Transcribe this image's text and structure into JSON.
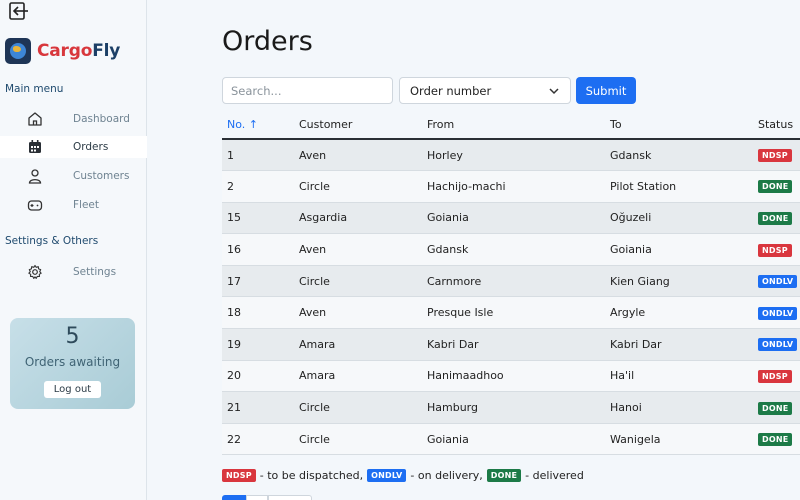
{
  "app": {
    "brand_part1": "Cargo",
    "brand_part2": "Fly"
  },
  "sidebar": {
    "main_menu_label": "Main menu",
    "items": [
      {
        "label": "Dashboard",
        "icon": "home-icon",
        "active": false
      },
      {
        "label": "Orders",
        "icon": "calendar-icon",
        "active": true
      },
      {
        "label": "Customers",
        "icon": "user-icon",
        "active": false
      },
      {
        "label": "Fleet",
        "icon": "gamepad-icon",
        "active": false
      }
    ],
    "settings_section_label": "Settings & Others",
    "settings_item": {
      "label": "Settings",
      "icon": "gear-icon"
    },
    "awaiting": {
      "count": "5",
      "label": "Orders awaiting",
      "logout_label": "Log out"
    }
  },
  "main": {
    "title": "Orders",
    "search": {
      "placeholder": "Search...",
      "value": ""
    },
    "sort_select": {
      "selected": "Order number"
    },
    "submit_label": "Submit",
    "table": {
      "headers": {
        "no": "No. ↑",
        "customer": "Customer",
        "from": "From",
        "to": "To",
        "status": "Status"
      },
      "rows": [
        {
          "no": "1",
          "customer": "Aven",
          "from": "Horley",
          "to": "Gdansk",
          "status": "NDSP"
        },
        {
          "no": "2",
          "customer": "Circle",
          "from": "Hachijo-machi",
          "to": "Pilot Station",
          "status": "DONE"
        },
        {
          "no": "15",
          "customer": "Asgardia",
          "from": "Goiania",
          "to": "Oğuzeli",
          "status": "DONE"
        },
        {
          "no": "16",
          "customer": "Aven",
          "from": "Gdansk",
          "to": "Goiania",
          "status": "NDSP"
        },
        {
          "no": "17",
          "customer": "Circle",
          "from": "Carnmore",
          "to": "Kien Giang",
          "status": "ONDLV"
        },
        {
          "no": "18",
          "customer": "Aven",
          "from": "Presque Isle",
          "to": "Argyle",
          "status": "ONDLV"
        },
        {
          "no": "19",
          "customer": "Amara",
          "from": "Kabri Dar",
          "to": "Kabri Dar",
          "status": "ONDLV"
        },
        {
          "no": "20",
          "customer": "Amara",
          "from": "Hanimaadhoo",
          "to": "Ha'il",
          "status": "NDSP"
        },
        {
          "no": "21",
          "customer": "Circle",
          "from": "Hamburg",
          "to": "Hanoi",
          "status": "DONE"
        },
        {
          "no": "22",
          "customer": "Circle",
          "from": "Goiania",
          "to": "Wanigela",
          "status": "DONE"
        }
      ]
    },
    "legend": {
      "ndsp_badge": "NDSP",
      "ndsp_text": "- to be dispatched,",
      "ondlv_badge": "ONDLV",
      "ondlv_text": "- on delivery,",
      "done_badge": "DONE",
      "done_text": "- delivered"
    }
  },
  "colors": {
    "accent": "#1d6ef2",
    "ndsp": "#d9363e",
    "done": "#1c7a47",
    "ondlv": "#1d6ef2",
    "brand_red": "#d8373c",
    "brand_navy": "#1c3f66"
  }
}
